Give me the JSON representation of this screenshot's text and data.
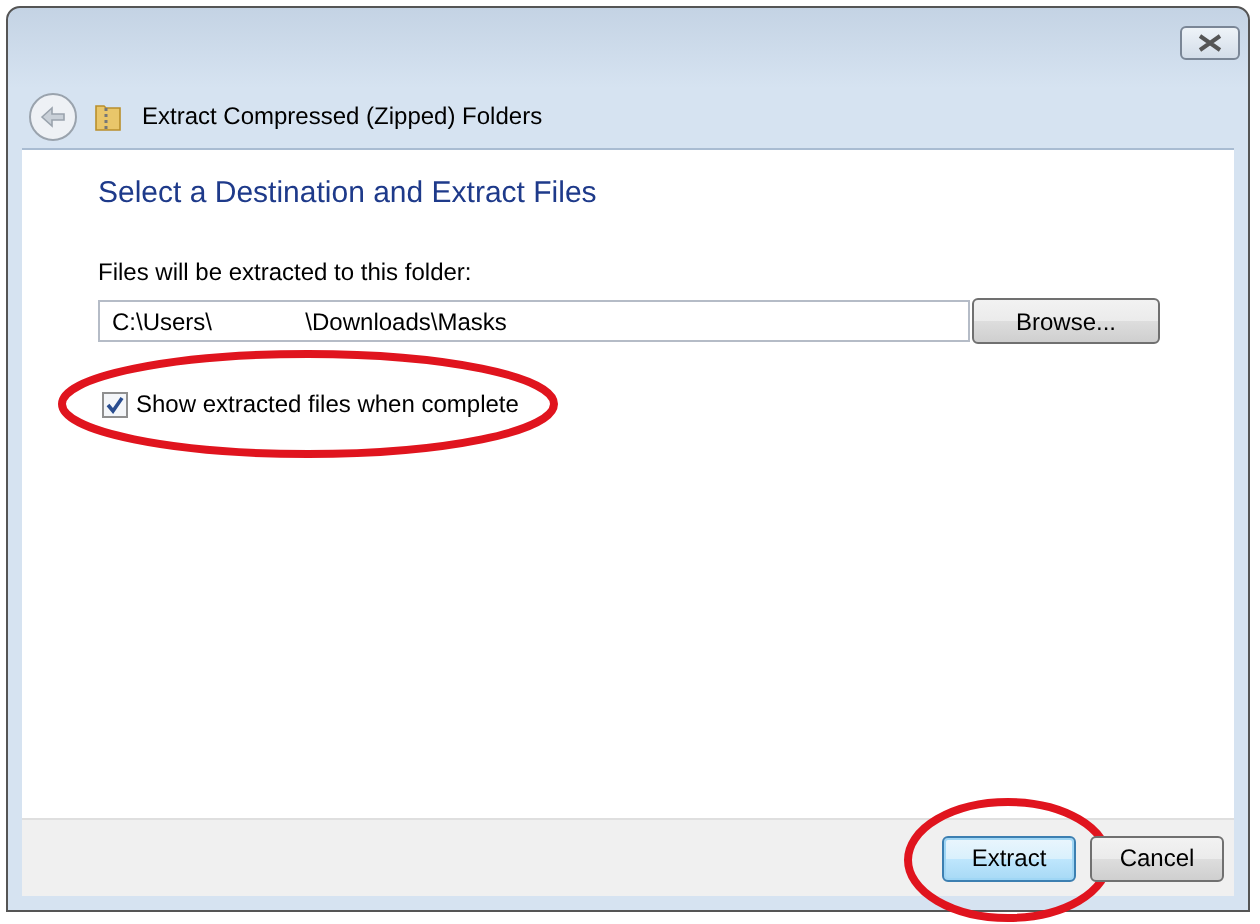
{
  "window": {
    "title": "Extract Compressed (Zipped) Folders"
  },
  "heading": "Select a Destination and Extract Files",
  "destination": {
    "label": "Files will be extracted to this folder:",
    "value": "C:\\Users\\              \\Downloads\\Masks",
    "browse": "Browse..."
  },
  "show_files": {
    "label": "Show extracted files when complete",
    "checked": true,
    "circled": true
  },
  "buttons": [
    {
      "label": "Extract",
      "default": true,
      "circled": true
    },
    {
      "label": "Cancel",
      "default": false,
      "circled": false
    }
  ]
}
